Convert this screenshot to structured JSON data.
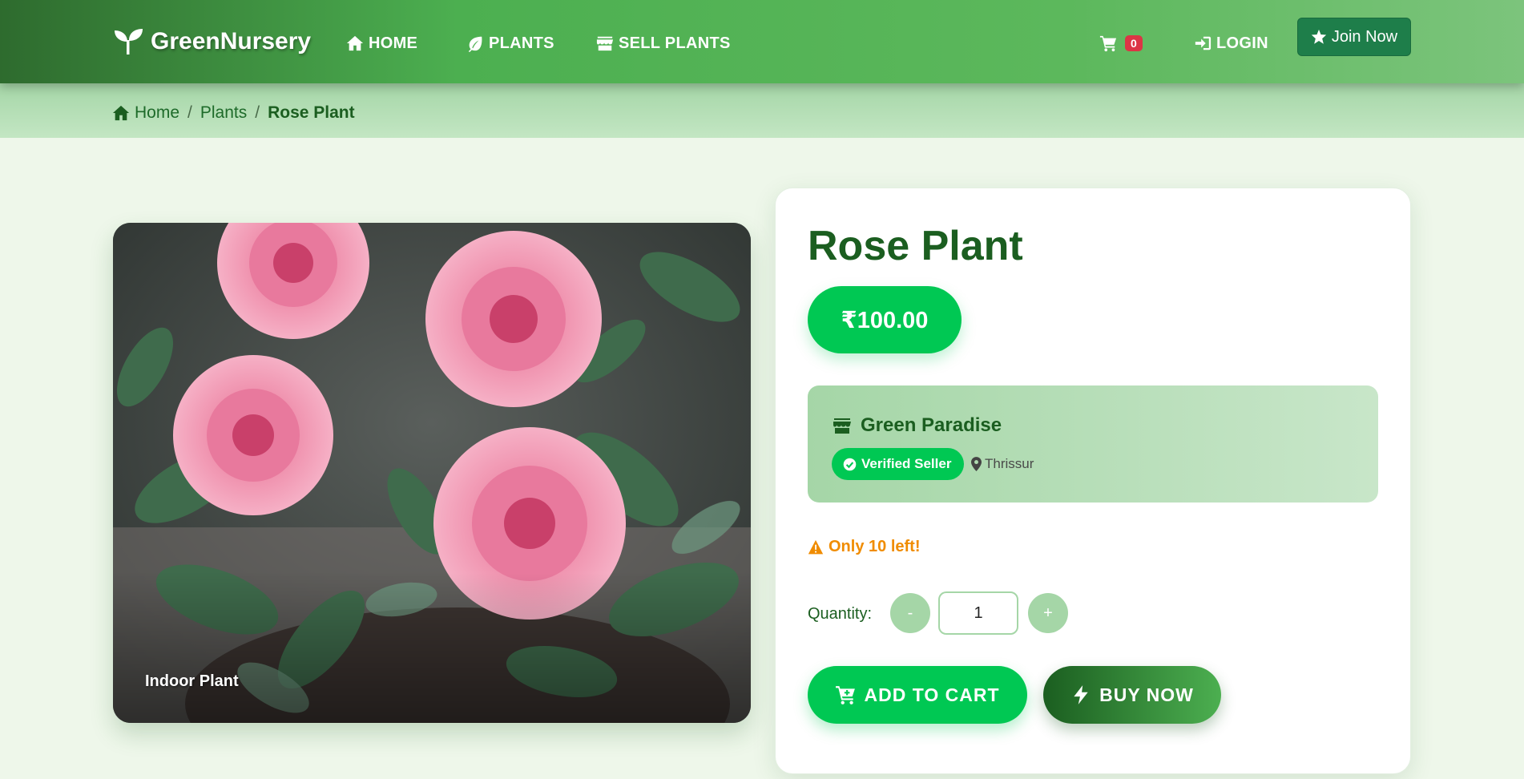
{
  "brand": {
    "name": "GreenNursery",
    "icon": "seedling-icon"
  },
  "nav": {
    "home": "HOME",
    "plants": "PLANTS",
    "sell": "SELL PLANTS",
    "cart_count": "0",
    "login": "LOGIN",
    "join": "Join Now"
  },
  "breadcrumb": {
    "home": "Home",
    "plants": "Plants",
    "current": "Rose Plant",
    "separator": "/"
  },
  "product": {
    "image_tag": "Indoor Plant",
    "title": "Rose Plant",
    "price": "₹100.00",
    "seller": "Green Paradise",
    "verified": "Verified Seller",
    "location": "Thrissur",
    "stock": "Only 10 left!",
    "quantity_label": "Quantity:",
    "quantity": "1",
    "minus": "-",
    "plus": "+",
    "add_to_cart": "ADD TO CART",
    "buy_now": "BUY NOW"
  },
  "colors": {
    "primary": "#1b5e20",
    "accent": "#00c853",
    "light": "#a5d6a7",
    "warning": "#f08c00",
    "badge": "#dc3545"
  }
}
